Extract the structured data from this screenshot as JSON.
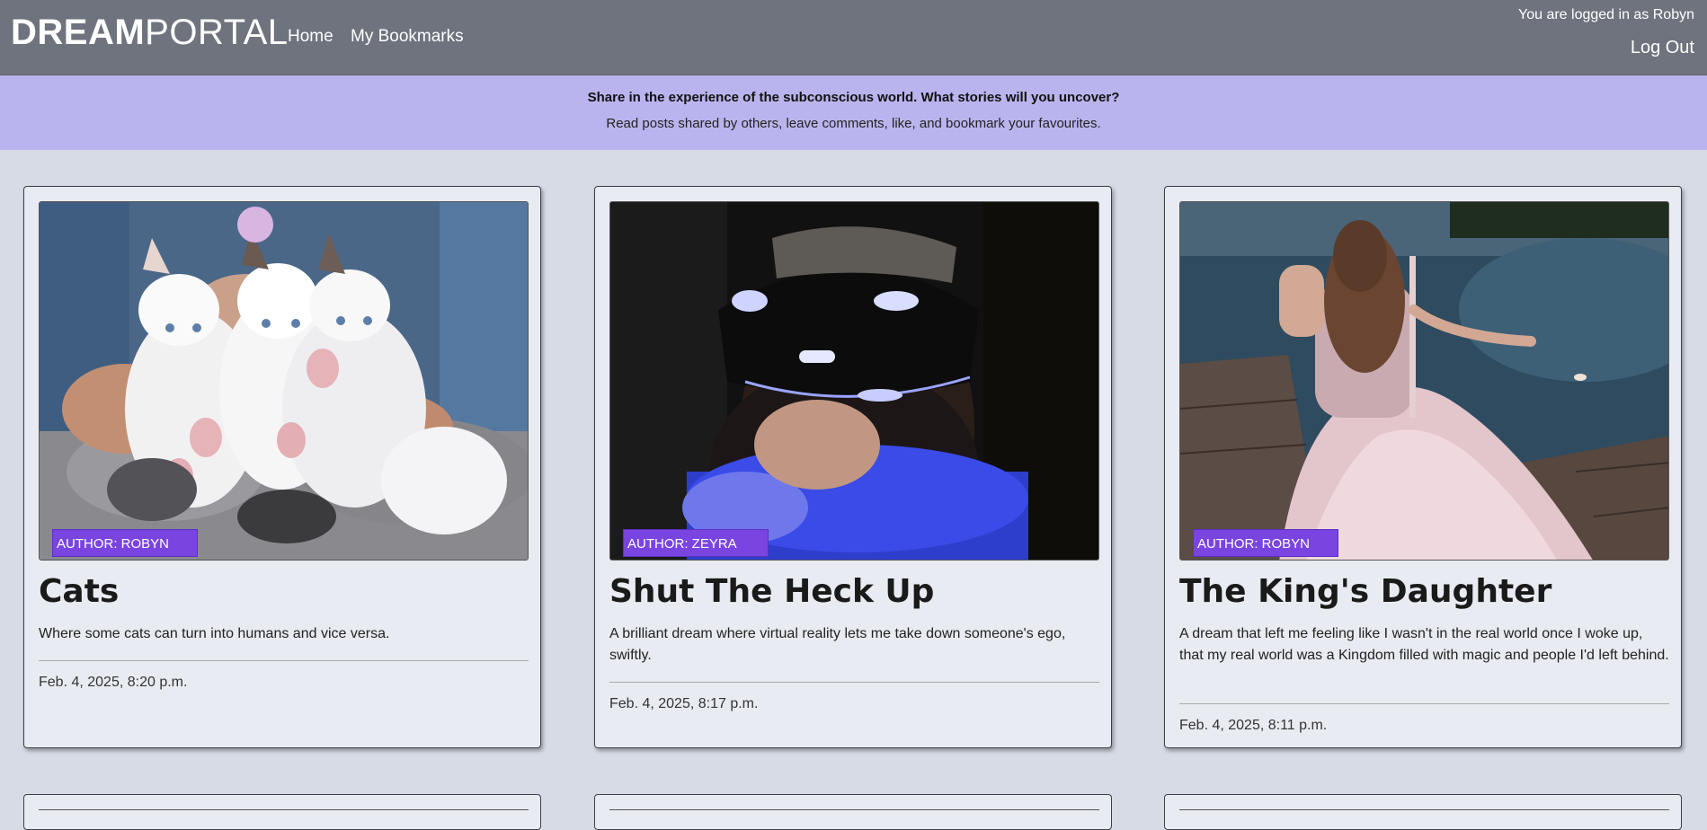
{
  "navbar": {
    "brand_bold": "DREAM",
    "brand_light": "PORTAL",
    "links": [
      "Home",
      "My Bookmarks"
    ],
    "user_status": "You are logged in as Robyn",
    "logout_label": "Log Out"
  },
  "banner": {
    "headline": "Share in the experience of the subconscious world. What stories will you uncover?",
    "subline": "Read posts shared by others, leave comments, like, and bookmark your favourites."
  },
  "posts": [
    {
      "author_label": "AUTHOR: ROBYN",
      "title": "Cats",
      "description": "Where some cats can turn into humans and vice versa.",
      "date": "Feb. 4, 2025, 8:20 p.m."
    },
    {
      "author_label": "AUTHOR: ZEYRA",
      "title": "Shut The Heck Up",
      "description": "A brilliant dream where virtual reality lets me take down someone's ego, swiftly.",
      "date": "Feb. 4, 2025, 8:17 p.m."
    },
    {
      "author_label": "AUTHOR: ROBYN",
      "title": "The King's Daughter",
      "description": "A dream that left me feeling like I wasn't in the real world once I woke up, that my real world was a Kingdom filled with magic and people I'd left behind.",
      "date": "Feb. 4, 2025, 8:11 p.m."
    }
  ],
  "colors": {
    "navbar_bg": "#6e737e",
    "banner_bg": "#bab4ee",
    "page_bg": "#d7dbe6",
    "card_bg": "#e9ebf2",
    "author_badge": "#7a44e0"
  }
}
